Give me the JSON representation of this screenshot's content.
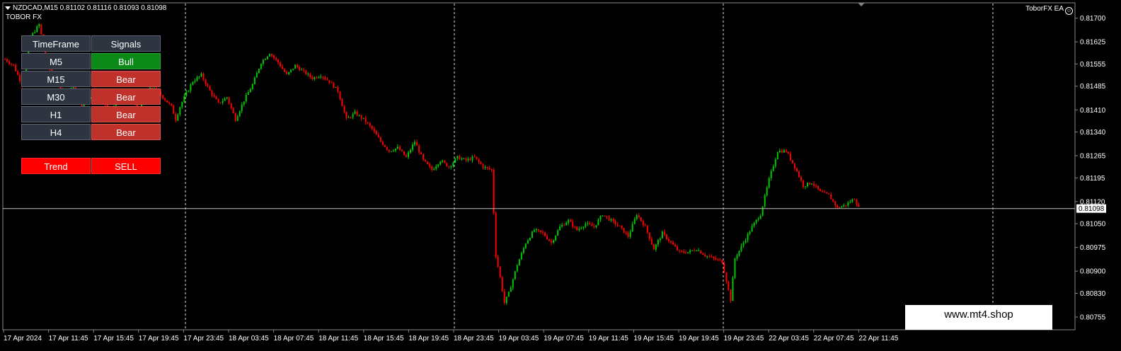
{
  "header": {
    "symbol_line": "NZDCAD,M15  0.81102 0.81116 0.81093 0.81098",
    "indicator_name": "TOBOR FX",
    "ea_label": "ToborFX EA",
    "ea_icon": "smiley-icon"
  },
  "panel": {
    "col_timeframe": "TimeFrame",
    "col_signals": "Signals",
    "rows": [
      {
        "tf": "M5",
        "signal": "Bull"
      },
      {
        "tf": "M15",
        "signal": "Bear"
      },
      {
        "tf": "M30",
        "signal": "Bear"
      },
      {
        "tf": "H1",
        "signal": "Bear"
      },
      {
        "tf": "H4",
        "signal": "Bear"
      }
    ],
    "trend_label": "Trend",
    "trend_value": "SELL"
  },
  "watermark": "www.mt4.shop",
  "colors": {
    "bull": "#00c800",
    "bear": "#ff0000",
    "bg": "#000000",
    "bid_line": "#c0c0c0"
  },
  "chart_data": {
    "type": "line",
    "title": "",
    "price_axis": [
      "0.81700",
      "0.81625",
      "0.81555",
      "0.81485",
      "0.81410",
      "0.81340",
      "0.81265",
      "0.81195",
      "0.81120",
      "0.81050",
      "0.80975",
      "0.80900",
      "0.80830",
      "0.80755"
    ],
    "current_price": "0.81098",
    "time_axis": [
      "17 Apr 2024",
      "17 Apr 11:45",
      "17 Apr 15:45",
      "17 Apr 19:45",
      "17 Apr 23:45",
      "18 Apr 03:45",
      "18 Apr 07:45",
      "18 Apr 11:45",
      "18 Apr 15:45",
      "18 Apr 19:45",
      "18 Apr 23:45",
      "19 Apr 03:45",
      "19 Apr 07:45",
      "19 Apr 11:45",
      "19 Apr 15:45",
      "19 Apr 19:45",
      "19 Apr 23:45",
      "22 Apr 03:45",
      "22 Apr 07:45",
      "22 Apr 11:45"
    ],
    "ylim": [
      0.80755,
      0.81735
    ],
    "path_close": [
      [
        0,
        0.8157
      ],
      [
        4,
        0.8155
      ],
      [
        8,
        0.8149
      ],
      [
        12,
        0.8164
      ],
      [
        16,
        0.8168
      ],
      [
        20,
        0.8155
      ],
      [
        24,
        0.815
      ],
      [
        28,
        0.8145
      ],
      [
        32,
        0.8149
      ],
      [
        36,
        0.8142
      ],
      [
        40,
        0.8145
      ],
      [
        44,
        0.8147
      ],
      [
        48,
        0.8141
      ],
      [
        52,
        0.8143
      ],
      [
        56,
        0.8146
      ],
      [
        60,
        0.8144
      ],
      [
        63,
        0.814
      ],
      [
        64,
        0.8144
      ],
      [
        66,
        0.8147
      ],
      [
        70,
        0.8148
      ],
      [
        74,
        0.8145
      ],
      [
        78,
        0.8142
      ],
      [
        80,
        0.8138
      ],
      [
        82,
        0.8142
      ],
      [
        84,
        0.8145
      ],
      [
        88,
        0.815
      ],
      [
        92,
        0.8152
      ],
      [
        96,
        0.8147
      ],
      [
        100,
        0.8143
      ],
      [
        104,
        0.8145
      ],
      [
        108,
        0.8138
      ],
      [
        112,
        0.8144
      ],
      [
        116,
        0.8149
      ],
      [
        120,
        0.8156
      ],
      [
        124,
        0.8159
      ],
      [
        128,
        0.8156
      ],
      [
        132,
        0.8152
      ],
      [
        136,
        0.8155
      ],
      [
        140,
        0.8153
      ],
      [
        144,
        0.8151
      ],
      [
        148,
        0.8152
      ],
      [
        152,
        0.815
      ],
      [
        156,
        0.8147
      ],
      [
        160,
        0.8138
      ],
      [
        164,
        0.814
      ],
      [
        168,
        0.8138
      ],
      [
        172,
        0.8135
      ],
      [
        176,
        0.8131
      ],
      [
        180,
        0.8128
      ],
      [
        184,
        0.8129
      ],
      [
        188,
        0.8126
      ],
      [
        192,
        0.8131
      ],
      [
        196,
        0.8125
      ],
      [
        200,
        0.8122
      ],
      [
        204,
        0.8125
      ],
      [
        208,
        0.8123
      ],
      [
        212,
        0.8126
      ],
      [
        216,
        0.8125
      ],
      [
        220,
        0.8126
      ],
      [
        224,
        0.8123
      ],
      [
        228,
        0.8122
      ],
      [
        230,
        0.8095
      ],
      [
        232,
        0.8088
      ],
      [
        234,
        0.808
      ],
      [
        236,
        0.8083
      ],
      [
        240,
        0.8092
      ],
      [
        244,
        0.8099
      ],
      [
        248,
        0.8103
      ],
      [
        252,
        0.8102
      ],
      [
        256,
        0.8099
      ],
      [
        260,
        0.8104
      ],
      [
        264,
        0.8106
      ],
      [
        268,
        0.8103
      ],
      [
        272,
        0.8105
      ],
      [
        276,
        0.8104
      ],
      [
        280,
        0.8108
      ],
      [
        284,
        0.8106
      ],
      [
        288,
        0.8104
      ],
      [
        292,
        0.8101
      ],
      [
        296,
        0.8108
      ],
      [
        300,
        0.8104
      ],
      [
        304,
        0.8097
      ],
      [
        308,
        0.8102
      ],
      [
        312,
        0.8099
      ],
      [
        316,
        0.8096
      ],
      [
        320,
        0.8096
      ],
      [
        324,
        0.8097
      ],
      [
        328,
        0.8095
      ],
      [
        332,
        0.8094
      ],
      [
        336,
        0.8093
      ],
      [
        338,
        0.8087
      ],
      [
        340,
        0.8081
      ],
      [
        342,
        0.8094
      ],
      [
        346,
        0.8099
      ],
      [
        350,
        0.8104
      ],
      [
        354,
        0.8108
      ],
      [
        358,
        0.8119
      ],
      [
        362,
        0.8128
      ],
      [
        366,
        0.8128
      ],
      [
        370,
        0.8123
      ],
      [
        374,
        0.8117
      ],
      [
        378,
        0.8118
      ],
      [
        382,
        0.8115
      ],
      [
        386,
        0.8114
      ],
      [
        390,
        0.811
      ],
      [
        394,
        0.8111
      ],
      [
        398,
        0.8113
      ],
      [
        400,
        0.811
      ]
    ]
  }
}
